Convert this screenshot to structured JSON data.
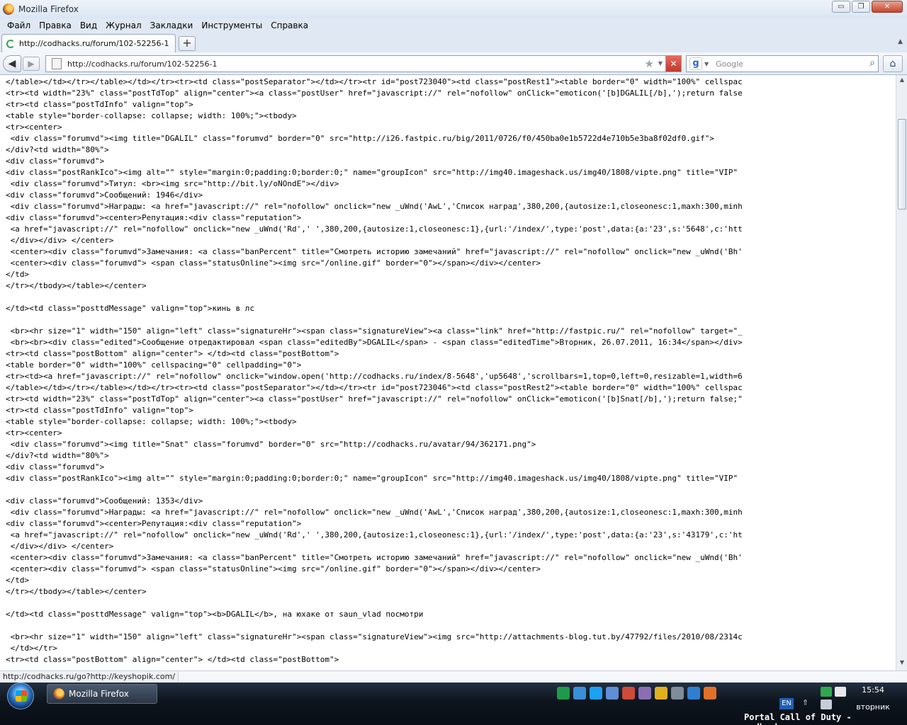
{
  "window": {
    "title": "Mozilla Firefox",
    "controls": {
      "minimize": "▭",
      "restore": "❐",
      "close": "✕"
    }
  },
  "menu": [
    "Файл",
    "Правка",
    "Вид",
    "Журнал",
    "Закладки",
    "Инструменты",
    "Справка"
  ],
  "tab": {
    "title": "http://codhacks.ru/forum/102-52256-1",
    "new_tab": "+"
  },
  "nav": {
    "url": "http://codhacks.ru/forum/102-52256-1",
    "search_placeholder": "Google",
    "search_engine_icon": "g"
  },
  "source_lines": [
    "</table></td></tr></table></td></tr><tr><td class=\"postSeparator\"></td></tr><tr id=\"post723040\"><td class=\"postRest1\"><table border=\"0\" width=\"100%\" cellspac",
    "<tr><td width=\"23%\" class=\"postTdTop\" align=\"center\"><a class=\"postUser\" href=\"javascript://\" rel=\"nofollow\" onClick=\"emoticon('[b]DGALIL[/b],');return false",
    "<tr><td class=\"postTdInfo\" valign=\"top\">",
    "<table style=\"border-collapse: collapse; width: 100%;\"><tbody>",
    "<tr><center>",
    " <div class=\"forumvd\"><img title=\"DGALIL\" class=\"forumvd\" border=\"0\" src=\"http://i26.fastpic.ru/big/2011/0726/f0/450ba0e1b5722d4e710b5e3ba8f02df0.gif\">",
    "</div?<td width=\"80%\">",
    "<div class=\"forumvd\">",
    "<div class=\"postRankIco\"><img alt=\"\" style=\"margin:0;padding:0;border:0;\" name=\"groupIcon\" src=\"http://img40.imageshack.us/img40/1808/vipte.png\" title=\"VIP\"",
    " <div class=\"forumvd\">Титул: <br><img src=\"http://bit.ly/oNOndE\"></div>",
    "<div class=\"forumvd\">Сообщений: 1946</div>",
    " <div class=\"forumvd\">Награды: <a href=\"javascript://\" rel=\"nofollow\" onclick=\"new _uWnd('AwL','Список наград',380,200,{autosize:1,closeonesc:1,maxh:300,minh",
    "<div class=\"forumvd\"><center>Репутация:<div class=\"reputation\">",
    " <a href=\"javascript://\" rel=\"nofollow\" onclick=\"new _uWnd('Rd',' ',380,200,{autosize:1,closeonesc:1},{url:'/index/',type:'post',data:{a:'23',s:'5648',c:'htt",
    " </div></div> </center>",
    " <center><div class=\"forumvd\">Замечания: <a class=\"banPercent\" title=\"Смотреть историю замечаний\" href=\"javascript://\" rel=\"nofollow\" onclick=\"new _uWnd('Bh'",
    " <center><div class=\"forumvd\"> <span class=\"statusOnline\"><img src=\"/online.gif\" border=\"0\"></span></div></center>",
    "</td>",
    "</tr></tbody></table></center>",
    "",
    "</td><td class=\"posttdMessage\" valign=\"top\">кинь в лс",
    "",
    " <br><hr size=\"1\" width=\"150\" align=\"left\" class=\"signatureHr\"><span class=\"signatureView\"><a class=\"link\" href=\"http://fastpic.ru/\" rel=\"nofollow\" target=\"_",
    " <br><br><div class=\"edited\">Сообщение отредактировал <span class=\"editedBy\">DGALIL</span> - <span class=\"editedTime\">Вторник, 26.07.2011, 16:34</span></div>",
    "<tr><td class=\"postBottom\" align=\"center\"> </td><td class=\"postBottom\">",
    "<table border=\"0\" width=\"100%\" cellspacing=\"0\" cellpadding=\"0\">",
    "<tr><td><a href=\"javascript://\" rel=\"nofollow\" onclick=\"window.open('http://codhacks.ru/index/8-5648','up5648','scrollbars=1,top=0,left=0,resizable=1,width=6",
    "</table></td></tr></table></td></tr><tr><td class=\"postSeparator\"></td></tr><tr id=\"post723046\"><td class=\"postRest2\"><table border=\"0\" width=\"100%\" cellspac",
    "<tr><td width=\"23%\" class=\"postTdTop\" align=\"center\"><a class=\"postUser\" href=\"javascript://\" rel=\"nofollow\" onClick=\"emoticon('[b]Snat[/b],');return false;\"",
    "<tr><td class=\"postTdInfo\" valign=\"top\">",
    "<table style=\"border-collapse: collapse; width: 100%;\"><tbody>",
    "<tr><center>",
    " <div class=\"forumvd\"><img title=\"Snat\" class=\"forumvd\" border=\"0\" src=\"http://codhacks.ru/avatar/94/362171.png\">",
    "</div?<td width=\"80%\">",
    "<div class=\"forumvd\">",
    "<div class=\"postRankIco\"><img alt=\"\" style=\"margin:0;padding:0;border:0;\" name=\"groupIcon\" src=\"http://img40.imageshack.us/img40/1808/vipte.png\" title=\"VIP\"",
    "",
    "<div class=\"forumvd\">Сообщений: 1353</div>",
    " <div class=\"forumvd\">Награды: <a href=\"javascript://\" rel=\"nofollow\" onclick=\"new _uWnd('AwL','Список наград',380,200,{autosize:1,closeonesc:1,maxh:300,minh",
    "<div class=\"forumvd\"><center>Репутация:<div class=\"reputation\">",
    " <a href=\"javascript://\" rel=\"nofollow\" onclick=\"new _uWnd('Rd',' ',380,200,{autosize:1,closeonesc:1},{url:'/index/',type:'post',data:{a:'23',s:'43179',c:'ht",
    " </div></div> </center>",
    " <center><div class=\"forumvd\">Замечания: <a class=\"banPercent\" title=\"Смотреть историю замечаний\" href=\"javascript://\" rel=\"nofollow\" onclick=\"new _uWnd('Bh'",
    " <center><div class=\"forumvd\"> <span class=\"statusOnline\"><img src=\"/online.gif\" border=\"0\"></span></div></center>",
    "</td>",
    "</tr></tbody></table></center>",
    "",
    "</td><td class=\"posttdMessage\" valign=\"top\"><b>DGALIL</b>, на юхаке от saun_vlad посмотри",
    "",
    " <br><hr size=\"1\" width=\"150\" align=\"left\" class=\"signatureHr\"><span class=\"signatureView\"><img src=\"http://attachments-blog.tut.by/47792/files/2010/08/2314c",
    " </td></tr>",
    "<tr><td class=\"postBottom\" align=\"center\"> </td><td class=\"postBottom\">"
  ],
  "status_bar": {
    "text": "http://codhacks.ru/go?http://keyshopik.com/"
  },
  "taskbar": {
    "window_button": "Mozilla Firefox",
    "language": "EN",
    "time": "15:54",
    "day": "вторник",
    "overlay_text": "Portal Call of Duty - codhacks.ru"
  },
  "tray_colors": [
    "#1f9a4a",
    "#3a8fd6",
    "#1da1f2",
    "#5e8fd8",
    "#cf4a3a",
    "#8b6fb3",
    "#e0b020",
    "#7f8c99",
    "#2f7fd1",
    "#e0702a"
  ]
}
